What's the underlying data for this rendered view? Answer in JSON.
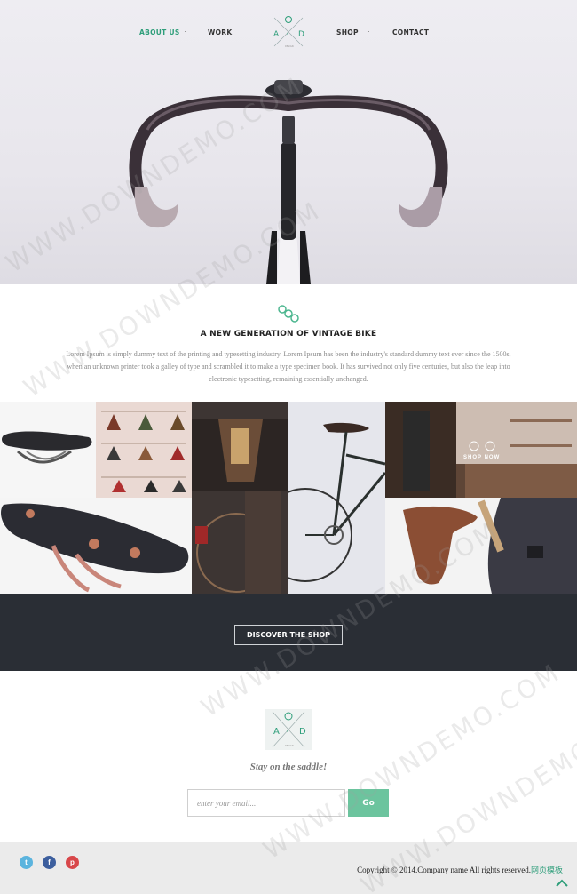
{
  "nav": {
    "left_items": [
      "ABOUT US",
      "WORK"
    ],
    "right_items": [
      "SHOP",
      "CONTACT"
    ],
    "separator": "·",
    "logo": {
      "letters": [
        "A",
        "O",
        "D",
        "C"
      ],
      "sub": "DESIGN"
    }
  },
  "intro": {
    "icon": "bike-gears-icon",
    "title": "A NEW GENERATION OF VINTAGE BIKE",
    "text": "Lorem Ipsum is simply dummy text of the printing and typesetting industry. Lorem Ipsum has been the industry's standard dummy text ever since the 1500s, when an unknown printer took a galley of type and scrambled it to make a type specimen book. It has survived not only five centuries, but also the leap into electronic typesetting, remaining essentially unchanged."
  },
  "gallery": {
    "shop_now": "SHOP NOW"
  },
  "band": {
    "button": "DISCOVER THE SHOP"
  },
  "newsletter": {
    "tagline": "Stay on the saddle!",
    "email_placeholder": "enter your email...",
    "button": "Go"
  },
  "footer": {
    "social": [
      {
        "name": "twitter-icon",
        "glyph": "t",
        "color": "#5bb4de"
      },
      {
        "name": "facebook-icon",
        "glyph": "f",
        "color": "#3d5f9e"
      },
      {
        "name": "pinterest-icon",
        "glyph": "p",
        "color": "#d8474a"
      }
    ],
    "copyright": "Copyright © 2014.Company name All rights reserved.",
    "copyright_cn": "网页模板"
  },
  "watermark": "WWW.DOWNDEMO.COM",
  "colors": {
    "accent": "#2e9e7a",
    "go": "#6cc49e",
    "band": "#2a2e35"
  }
}
